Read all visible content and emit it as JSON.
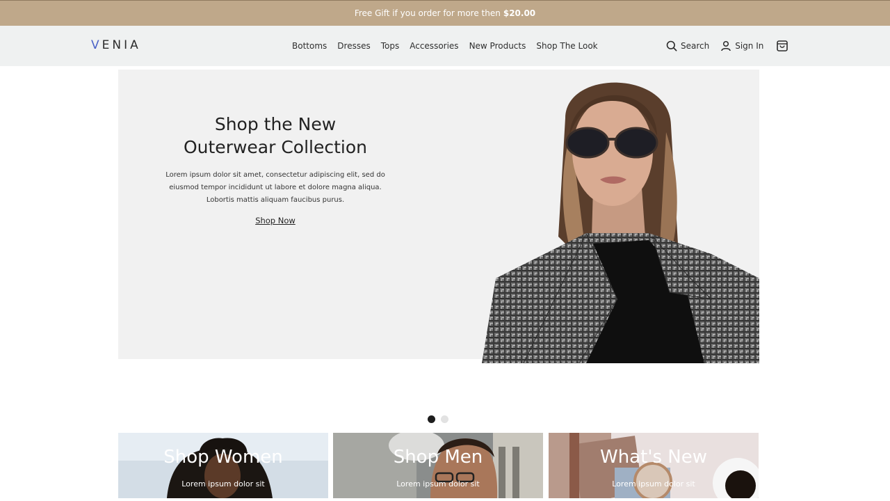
{
  "promo": {
    "text": "Free Gift if you order for more then",
    "amount": "$20.00",
    "color": "#bfa88a"
  },
  "header": {
    "logo_first": "V",
    "logo_rest": "ENIA",
    "nav": [
      "Bottoms",
      "Dresses",
      "Tops",
      "Accessories",
      "New Products",
      "Shop The Look"
    ],
    "search_label": "Search",
    "signin_label": "Sign In",
    "icons": {
      "search": "search-icon",
      "account": "user-icon",
      "cart": "shopping-bag-icon"
    }
  },
  "hero": {
    "title_line1": "Shop the New",
    "title_line2": "Outerwear Collection",
    "body": "Lorem ipsum dolor sit amet, consectetur adipiscing elit, sed do eiusmod tempor incididunt ut labore et dolore magna aliqua. Lobortis mattis aliquam faucibus purus.",
    "cta": "Shop Now"
  },
  "carousel": {
    "slides": 2,
    "active": 1
  },
  "tiles": [
    {
      "title": "Shop Women",
      "subtitle": "Lorem ipsum dolor sit"
    },
    {
      "title": "Shop Men",
      "subtitle": "Lorem ipsum dolor sit"
    },
    {
      "title": "What's New",
      "subtitle": "Lorem ipsum dolor sit"
    }
  ]
}
